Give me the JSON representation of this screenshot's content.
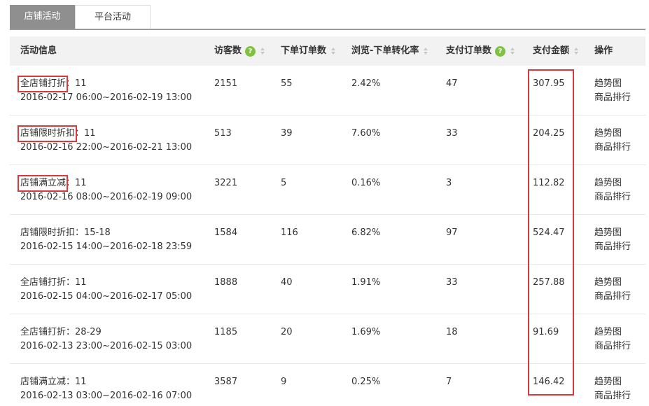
{
  "tabs": [
    {
      "label": "店铺活动",
      "active": true
    },
    {
      "label": "平台活动",
      "active": false
    }
  ],
  "columns": {
    "info": "活动信息",
    "visitors": "访客数",
    "orders": "下单订单数",
    "conversion": "浏览-下单转化率",
    "paid_orders": "支付订单数",
    "amount": "支付金额",
    "actions": "操作"
  },
  "help_icon_glyph": "?",
  "actions": {
    "trend": "趋势图",
    "ranking": "商品排行"
  },
  "highlight_color": "#d9393d",
  "rows": [
    {
      "name": "全店铺打折",
      "code": "：11",
      "period": "2016-02-17 06:00~2016-02-19 13:00",
      "visitors": "2151",
      "orders": "55",
      "conversion": "2.42%",
      "paid_orders": "47",
      "amount": "307.95",
      "highlighted": true
    },
    {
      "name": "店铺限时折扣",
      "code": "：11",
      "period": "2016-02-16 22:00~2016-02-21 13:00",
      "visitors": "513",
      "orders": "39",
      "conversion": "7.60%",
      "paid_orders": "33",
      "amount": "204.25",
      "highlighted": true
    },
    {
      "name": "店铺满立减",
      "code": "：11",
      "period": "2016-02-16 08:00~2016-02-19 09:00",
      "visitors": "3221",
      "orders": "5",
      "conversion": "0.16%",
      "paid_orders": "3",
      "amount": "112.82",
      "highlighted": true
    },
    {
      "name": "店铺限时折扣",
      "code": "：15-18",
      "period": "2016-02-15 14:00~2016-02-18 23:59",
      "visitors": "1584",
      "orders": "116",
      "conversion": "6.82%",
      "paid_orders": "97",
      "amount": "524.47",
      "highlighted": false
    },
    {
      "name": "全店铺打折",
      "code": "：11",
      "period": "2016-02-15 04:00~2016-02-17 05:00",
      "visitors": "1888",
      "orders": "40",
      "conversion": "1.91%",
      "paid_orders": "33",
      "amount": "257.88",
      "highlighted": false
    },
    {
      "name": "全店铺打折",
      "code": "：28-29",
      "period": "2016-02-13 23:00~2016-02-15 03:00",
      "visitors": "1185",
      "orders": "20",
      "conversion": "1.69%",
      "paid_orders": "18",
      "amount": "91.69",
      "highlighted": false
    },
    {
      "name": "店铺满立减",
      "code": "：11",
      "period": "2016-02-13 03:00~2016-02-16 07:00",
      "visitors": "3587",
      "orders": "9",
      "conversion": "0.25%",
      "paid_orders": "7",
      "amount": "146.42",
      "highlighted": false
    }
  ]
}
